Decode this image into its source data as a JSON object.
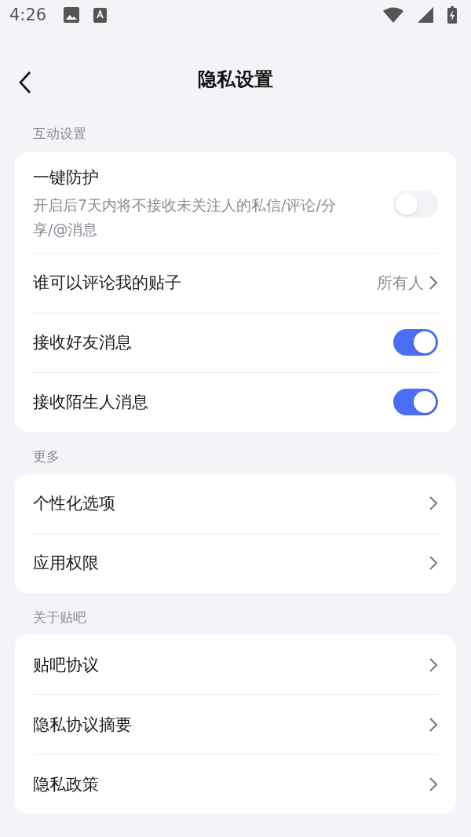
{
  "status_bar": {
    "time": "4:26"
  },
  "header": {
    "title": "隐私设置"
  },
  "sections": [
    {
      "title": "互动设置",
      "items": [
        {
          "kind": "toggle",
          "label": "一键防护",
          "description": "开启后7天内将不接收未关注人的私信/评论/分享/@消息",
          "on": false
        },
        {
          "kind": "link",
          "label": "谁可以评论我的贴子",
          "value": "所有人"
        },
        {
          "kind": "toggle",
          "label": "接收好友消息",
          "on": true
        },
        {
          "kind": "toggle",
          "label": "接收陌生人消息",
          "on": true
        }
      ]
    },
    {
      "title": "更多",
      "items": [
        {
          "kind": "link",
          "label": "个性化选项"
        },
        {
          "kind": "link",
          "label": "应用权限"
        }
      ]
    },
    {
      "title": "关于贴吧",
      "items": [
        {
          "kind": "link",
          "label": "贴吧协议"
        },
        {
          "kind": "link",
          "label": "隐私协议摘要"
        },
        {
          "kind": "link",
          "label": "隐私政策"
        }
      ]
    }
  ]
}
